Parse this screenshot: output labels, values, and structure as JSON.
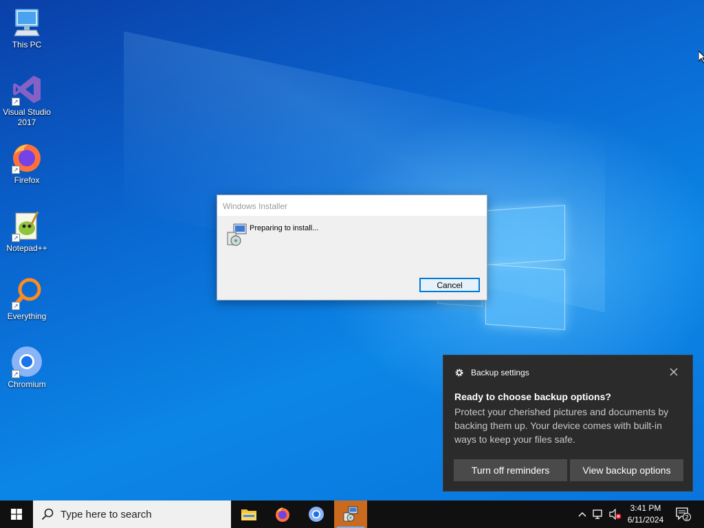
{
  "desktop": {
    "icons": [
      {
        "label": "This PC"
      },
      {
        "label": "Visual Studio 2017"
      },
      {
        "label": "Firefox"
      },
      {
        "label": "Notepad++"
      },
      {
        "label": "Everything"
      },
      {
        "label": "Chromium"
      }
    ]
  },
  "installer": {
    "title": "Windows Installer",
    "message": "Preparing to install...",
    "cancel_label": "Cancel"
  },
  "toast": {
    "app_name": "Backup settings",
    "heading": "Ready to choose backup options?",
    "body": "Protect your cherished pictures and documents by backing them up. Your device comes with built-in ways to keep your files safe.",
    "button_1": "Turn off reminders",
    "button_2": "View backup options"
  },
  "taskbar": {
    "search_placeholder": "Type here to search",
    "apps": [
      "file-explorer-icon",
      "firefox-icon",
      "chromium-icon",
      "windows-installer-icon"
    ],
    "time": "3:41 PM",
    "date": "6/11/2024",
    "notification_count": "2"
  },
  "colors": {
    "accent": "#0078d7",
    "toast_bg": "#2b2b2b",
    "taskbar_bg": "#101010",
    "active_app": "#c96a1f"
  }
}
